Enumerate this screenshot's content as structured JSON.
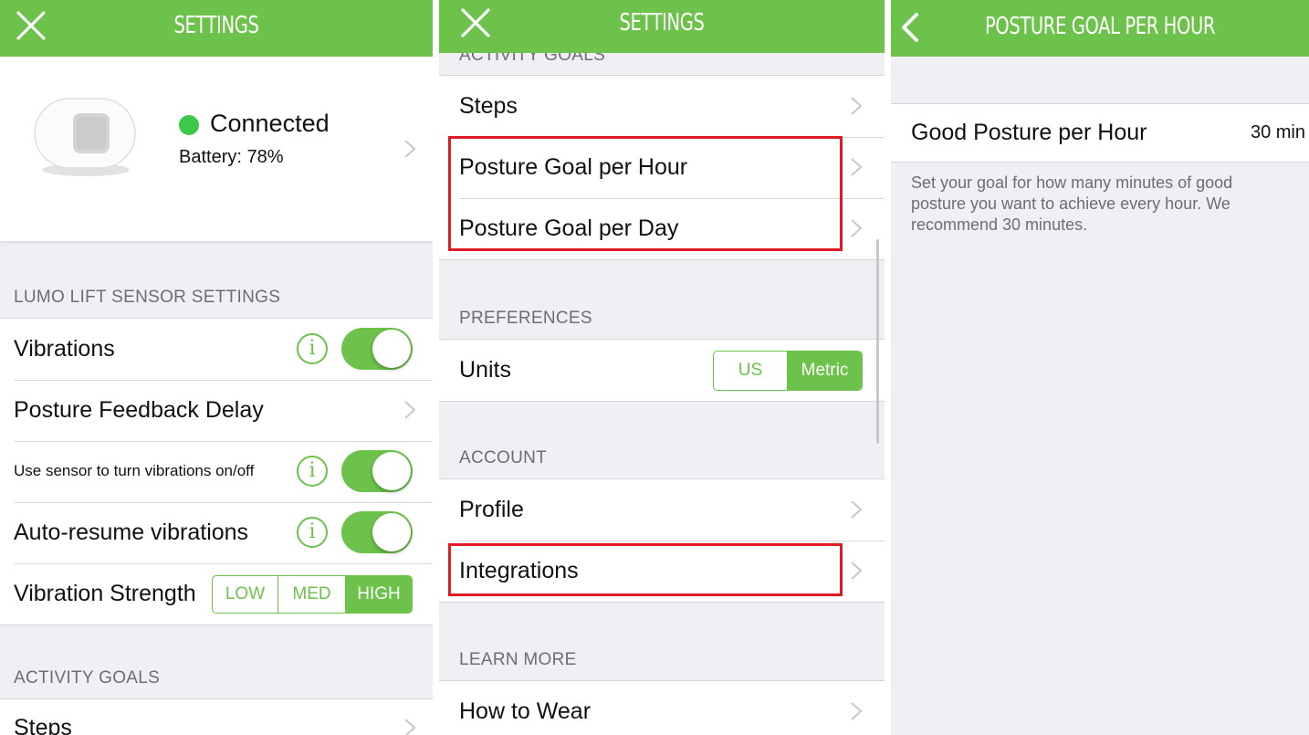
{
  "colors": {
    "accent": "#6cc24a",
    "highlight": "#e01b24",
    "background": "#efeff4"
  },
  "left": {
    "nav": {
      "title": "SETTINGS",
      "icon": "close-icon"
    },
    "device": {
      "status": "Connected",
      "battery": "Battery: 78%",
      "status_color": "#3ec84a"
    },
    "sensor_header": "LUMO LIFT SENSOR SETTINGS",
    "rows": {
      "vibrations": "Vibrations",
      "feedback_delay": "Posture Feedback Delay",
      "sensor_toggle": "Use sensor to turn vibrations on/off",
      "auto_resume": "Auto-resume vibrations",
      "strength": "Vibration Strength"
    },
    "toggles": {
      "vibrations": true,
      "sensor_toggle": true,
      "auto_resume": true
    },
    "strength_options": [
      "LOW",
      "MED",
      "HIGH"
    ],
    "strength_selected": "HIGH",
    "activity_header": "ACTIVITY GOALS",
    "steps": "Steps"
  },
  "middle": {
    "nav": {
      "title": "SETTINGS",
      "icon": "close-icon"
    },
    "activity_header": "ACTIVITY GOALS",
    "rows": {
      "steps": "Steps",
      "posture_hour": "Posture Goal per Hour",
      "posture_day": "Posture Goal per Day",
      "units": "Units",
      "profile": "Profile",
      "integrations": "Integrations",
      "how_to_wear": "How to Wear"
    },
    "preferences_header": "PREFERENCES",
    "units_options": [
      "US",
      "Metric"
    ],
    "units_selected": "Metric",
    "account_header": "ACCOUNT",
    "learn_header": "LEARN MORE"
  },
  "right": {
    "nav": {
      "title": "POSTURE GOAL PER HOUR",
      "icon": "back-chevron-icon"
    },
    "row_label": "Good Posture per Hour",
    "row_value": "30 min",
    "description": "Set your goal for how many minutes of good posture you want to achieve every hour. We recommend 30 minutes."
  }
}
